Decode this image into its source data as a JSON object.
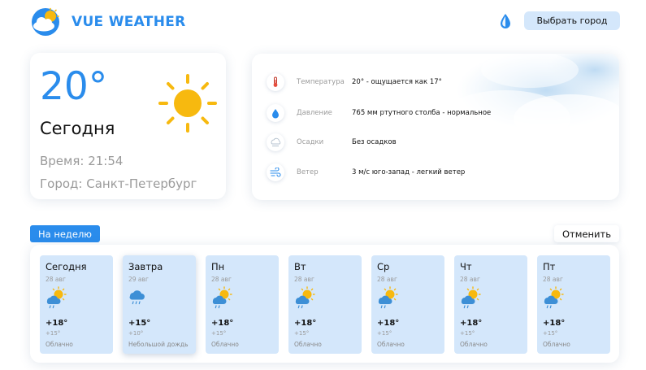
{
  "header": {
    "brand": "VUE WEATHER",
    "select_city_label": "Выбрать город"
  },
  "current": {
    "temp": "20°",
    "day_label": "Сегодня",
    "time": "Время: 21:54",
    "city": "Город: Санкт-Петербург"
  },
  "details": [
    {
      "icon": "thermometer-icon",
      "label": "Температура",
      "value": "20° - ощущается как 17°"
    },
    {
      "icon": "water-drop-icon",
      "label": "Давление",
      "value": "765 мм ртутного столба - нормальное"
    },
    {
      "icon": "precipitation-icon",
      "label": "Осадки",
      "value": "Без осадков"
    },
    {
      "icon": "wind-icon",
      "label": "Ветер",
      "value": "3 м/с юго-запад - легкий ветер"
    }
  ],
  "controls": {
    "week_label": "На неделю",
    "cancel_label": "Отменить"
  },
  "forecast": [
    {
      "day": "Сегодня",
      "date": "28 авг",
      "temp": "+18°",
      "feels": "+15°",
      "desc": "Облачно",
      "icon": "sun-cloud-rain-icon"
    },
    {
      "day": "Завтра",
      "date": "29 авг",
      "temp": "+15°",
      "feels": "+10°",
      "desc": "Небольшой дождь",
      "icon": "cloud-rain-icon"
    },
    {
      "day": "Пн",
      "date": "28 авг",
      "temp": "+18°",
      "feels": "+15°",
      "desc": "Облачно",
      "icon": "sun-cloud-rain-icon"
    },
    {
      "day": "Вт",
      "date": "28 авг",
      "temp": "+18°",
      "feels": "+15°",
      "desc": "Облачно",
      "icon": "sun-cloud-rain-icon"
    },
    {
      "day": "Ср",
      "date": "28 авг",
      "temp": "+18°",
      "feels": "+15°",
      "desc": "Облачно",
      "icon": "sun-cloud-rain-icon"
    },
    {
      "day": "Чт",
      "date": "28 авг",
      "temp": "+18°",
      "feels": "+15°",
      "desc": "Облачно",
      "icon": "sun-cloud-rain-icon"
    },
    {
      "day": "Пт",
      "date": "28 авг",
      "temp": "+18°",
      "feels": "+15°",
      "desc": "Облачно",
      "icon": "sun-cloud-rain-icon"
    }
  ],
  "colors": {
    "accent": "#2a8cec",
    "card_tint": "#d4e7fb",
    "sun": "#f7b90f",
    "muted_text": "#9a9a9a"
  }
}
